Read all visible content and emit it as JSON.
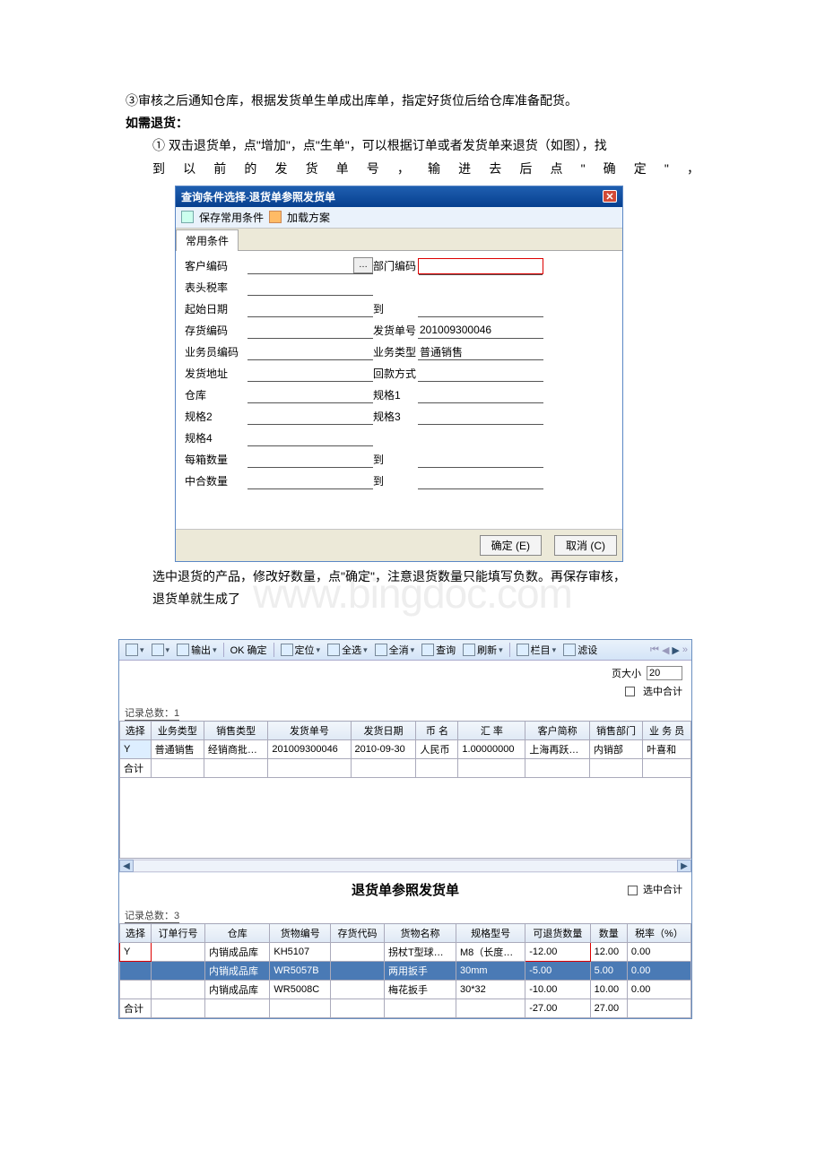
{
  "doc": {
    "line1": "③审核之后通知仓库，根据发货单生单成出库单，指定好货位后给仓库准备配货。",
    "line2": "如需退货：",
    "line3a": "① 双击退货单，点\"增加\"，点\"生单\"，可以根据订单或者发货单来退货（如图），找",
    "line3b": "到以前的发货单号，输进去后点\"确定\"，",
    "line4": "选中退货的产品，修改好数量，点\"确定\"，注意退货数量只能填写负数。再保存审核，",
    "line5": "退货单就生成了"
  },
  "dialog": {
    "title": "查询条件选择-退货单参照发货单",
    "save": "保存常用条件",
    "load": "加载方案",
    "tab": "常用条件",
    "labels": {
      "cust": "客户编码",
      "dept": "部门编码",
      "tax": "表头税率",
      "sdate": "起始日期",
      "to": "到",
      "stock": "存货编码",
      "shipno": "发货单号",
      "shipno_val": "201009300046",
      "emp": "业务员编码",
      "biztype": "业务类型",
      "biztype_val": "普通销售",
      "addr": "发货地址",
      "payback": "回款方式",
      "wh": "仓库",
      "spec1": "规格1",
      "spec2": "规格2",
      "spec3": "规格3",
      "spec4": "规格4",
      "boxqty": "每箱数量",
      "to2": "到",
      "midqty": "中合数量",
      "to3": "到"
    },
    "ok": "确定 (E)",
    "cancel": "取消 (C)"
  },
  "win2": {
    "menu": {
      "output": "输出",
      "ok": "OK 确定",
      "locate": "定位",
      "selall": "全选",
      "deselall": "全消",
      "query": "查询",
      "refresh": "刷新",
      "columns": "栏目",
      "filter": "滤设"
    },
    "pagesize_lbl": "页大小",
    "pagesize_val": "20",
    "selsum": "选中合计",
    "rec1": "记录总数：1",
    "grid1": {
      "h": [
        "选择",
        "业务类型",
        "销售类型",
        "发货单号",
        "发货日期",
        "币 名",
        "汇 率",
        "客户简称",
        "销售部门",
        "业 务 员"
      ],
      "r": [
        "Y",
        "普通销售",
        "经销商批…",
        "201009300046",
        "2010-09-30",
        "人民币",
        "1.00000000",
        "上海再跃…",
        "内销部",
        "叶喜和"
      ],
      "sum": "合计"
    },
    "title2": "退货单参照发货单",
    "rec2": "记录总数：3",
    "grid2": {
      "h": [
        "选择",
        "订单行号",
        "仓库",
        "货物编号",
        "存货代码",
        "货物名称",
        "规格型号",
        "可退货数量",
        "数量",
        "税率（%）"
      ],
      "rows": [
        {
          "c": [
            "Y",
            "",
            "内销成品库",
            "KH5107",
            "",
            "拐杖T型球…",
            "M8（长度…",
            "-12.00",
            "12.00",
            "0.00"
          ],
          "hi": false,
          "sel": true
        },
        {
          "c": [
            "",
            "",
            "内销成品库",
            "WR5057B",
            "",
            "两用扳手",
            "30mm",
            "-5.00",
            "5.00",
            "0.00"
          ],
          "hi": true,
          "sel": false
        },
        {
          "c": [
            "",
            "",
            "内销成品库",
            "WR5008C",
            "",
            "梅花扳手",
            "30*32",
            "-10.00",
            "10.00",
            "0.00"
          ],
          "hi": false,
          "sel": false
        }
      ],
      "sum": [
        "合计",
        "",
        "",
        "",
        "",
        "",
        "",
        "-27.00",
        "27.00",
        ""
      ]
    }
  }
}
